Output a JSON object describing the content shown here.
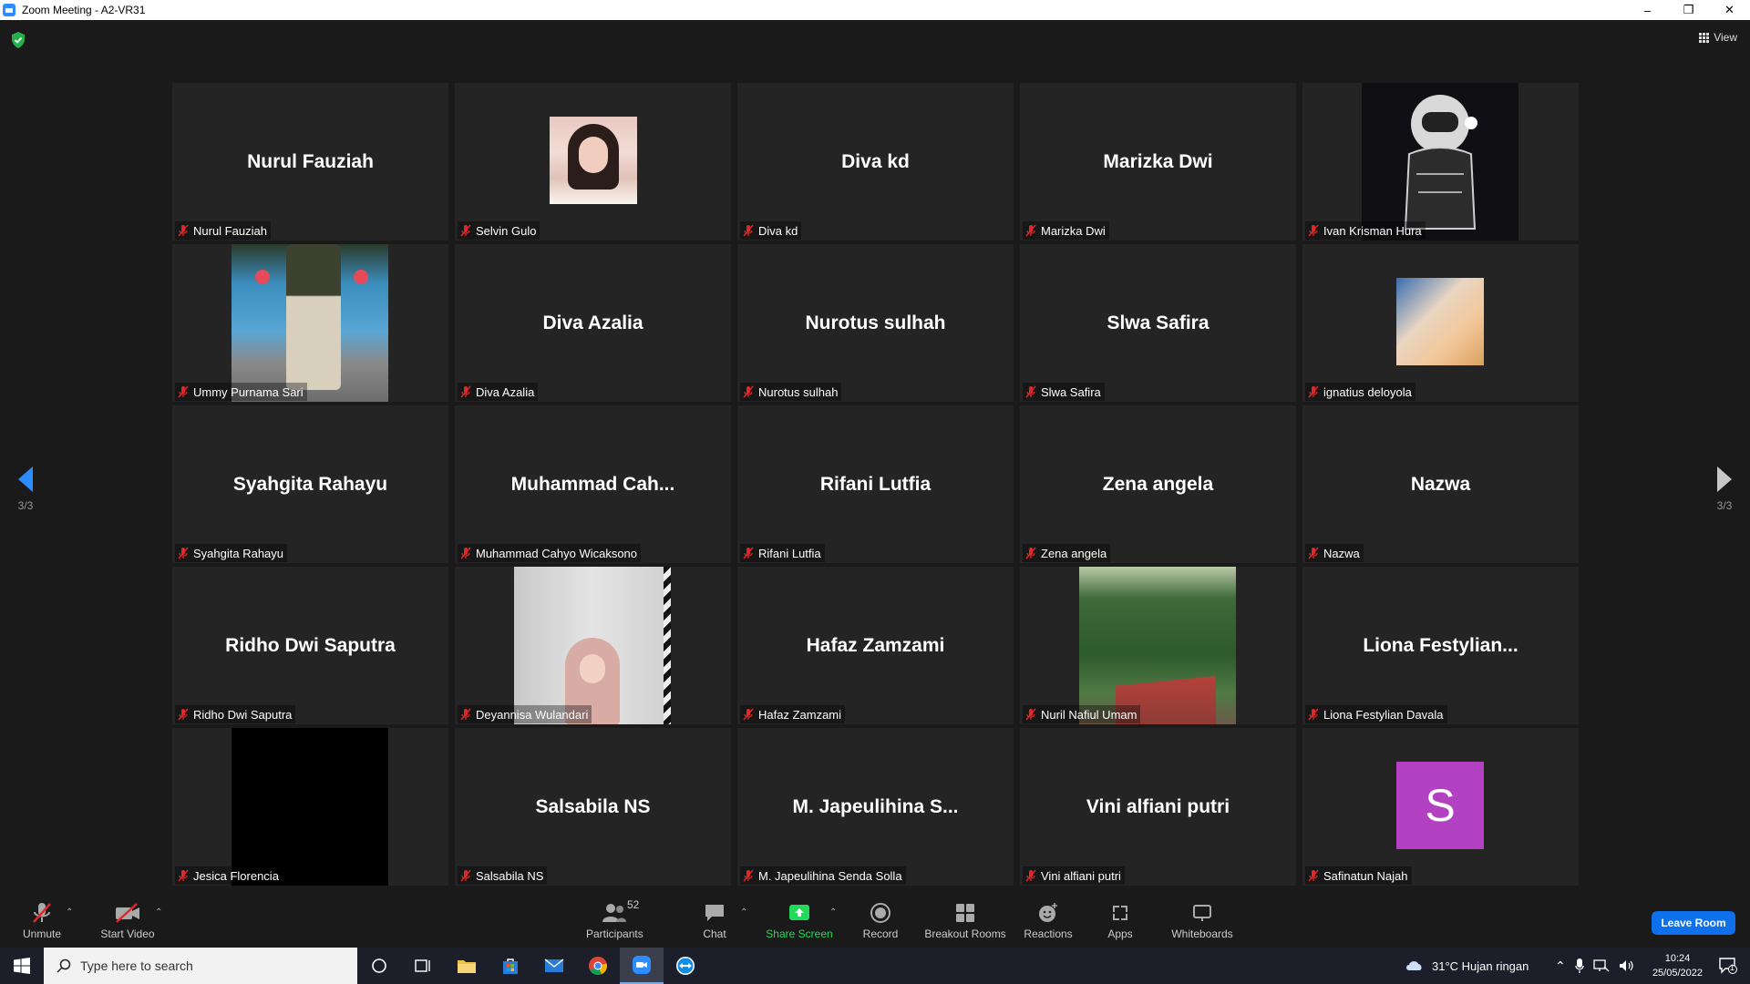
{
  "window": {
    "title": "Zoom Meeting - A2-VR31",
    "minimize": "–",
    "restore": "❐",
    "close": "✕"
  },
  "header": {
    "view_label": "View"
  },
  "pager": {
    "left_page": "3/3",
    "right_page": "3/3"
  },
  "participants": [
    {
      "display_name": "Nurul Fauziah",
      "label": "Nurul Fauziah",
      "video": "none"
    },
    {
      "display_name": "",
      "label": "Selvin Gulo",
      "video": "selvin"
    },
    {
      "display_name": "Diva kd",
      "label": "Diva kd",
      "video": "none"
    },
    {
      "display_name": "Marizka Dwi",
      "label": "Marizka Dwi",
      "video": "none"
    },
    {
      "display_name": "",
      "label": "Ivan Krisman Hura",
      "video": "ivan"
    },
    {
      "display_name": "",
      "label": "Ummy Purnama Sari",
      "video": "ummy"
    },
    {
      "display_name": "Diva Azalia",
      "label": "Diva Azalia",
      "video": "none"
    },
    {
      "display_name": "Nurotus sulhah",
      "label": "Nurotus sulhah",
      "video": "none"
    },
    {
      "display_name": "Slwa Safira",
      "label": "Slwa Safira",
      "video": "none"
    },
    {
      "display_name": "",
      "label": "ignatius deloyola",
      "video": "ignatius"
    },
    {
      "display_name": "Syahgita Rahayu",
      "label": "Syahgita Rahayu",
      "video": "none"
    },
    {
      "display_name": "Muhammad  Cah...",
      "label": "Muhammad Cahyo Wicaksono",
      "video": "none"
    },
    {
      "display_name": "Rifani Lutfia",
      "label": "Rifani Lutfia",
      "video": "none"
    },
    {
      "display_name": "Zena angela",
      "label": "Zena angela",
      "video": "none"
    },
    {
      "display_name": "Nazwa",
      "label": "Nazwa",
      "video": "none"
    },
    {
      "display_name": "Ridho Dwi Saputra",
      "label": "Ridho Dwi Saputra",
      "video": "none"
    },
    {
      "display_name": "",
      "label": "Deyannisa Wulandari",
      "video": "deyannisa"
    },
    {
      "display_name": "Hafaz Zamzami",
      "label": "Hafaz Zamzami",
      "video": "none"
    },
    {
      "display_name": "",
      "label": "Nuril Nafiul Umam",
      "video": "nuril"
    },
    {
      "display_name": "Liona  Festylian...",
      "label": "Liona Festylian Davala",
      "video": "none"
    },
    {
      "display_name": "",
      "label": "Jesica Florencia",
      "video": "jesica"
    },
    {
      "display_name": "Salsabila NS",
      "label": "Salsabila NS",
      "video": "none"
    },
    {
      "display_name": "M. Japeulihina  S...",
      "label": "M. Japeulihina Senda Solla",
      "video": "none"
    },
    {
      "display_name": "Vini alfiani putri",
      "label": "Vini alfiani putri",
      "video": "none"
    },
    {
      "display_name": "",
      "label": "Safinatun Najah",
      "video": "safinatun",
      "avatar_letter": "S"
    }
  ],
  "toolbar": {
    "unmute": "Unmute",
    "start_video": "Start Video",
    "participants": "Participants",
    "participants_count": "52",
    "chat": "Chat",
    "share_screen": "Share Screen",
    "record": "Record",
    "breakout_rooms": "Breakout Rooms",
    "reactions": "Reactions",
    "apps": "Apps",
    "whiteboards": "Whiteboards",
    "leave": "Leave Room"
  },
  "taskbar": {
    "search_placeholder": "Type here to search",
    "weather": "31°C  Hujan ringan",
    "time": "10:24",
    "date": "25/05/2022",
    "notification_count": "1"
  },
  "colors": {
    "accent": "#2d8cff",
    "share_green": "#23d959",
    "leave_blue": "#0e71eb",
    "muted_red": "#e02828",
    "avatar_purple": "#b342c2"
  }
}
